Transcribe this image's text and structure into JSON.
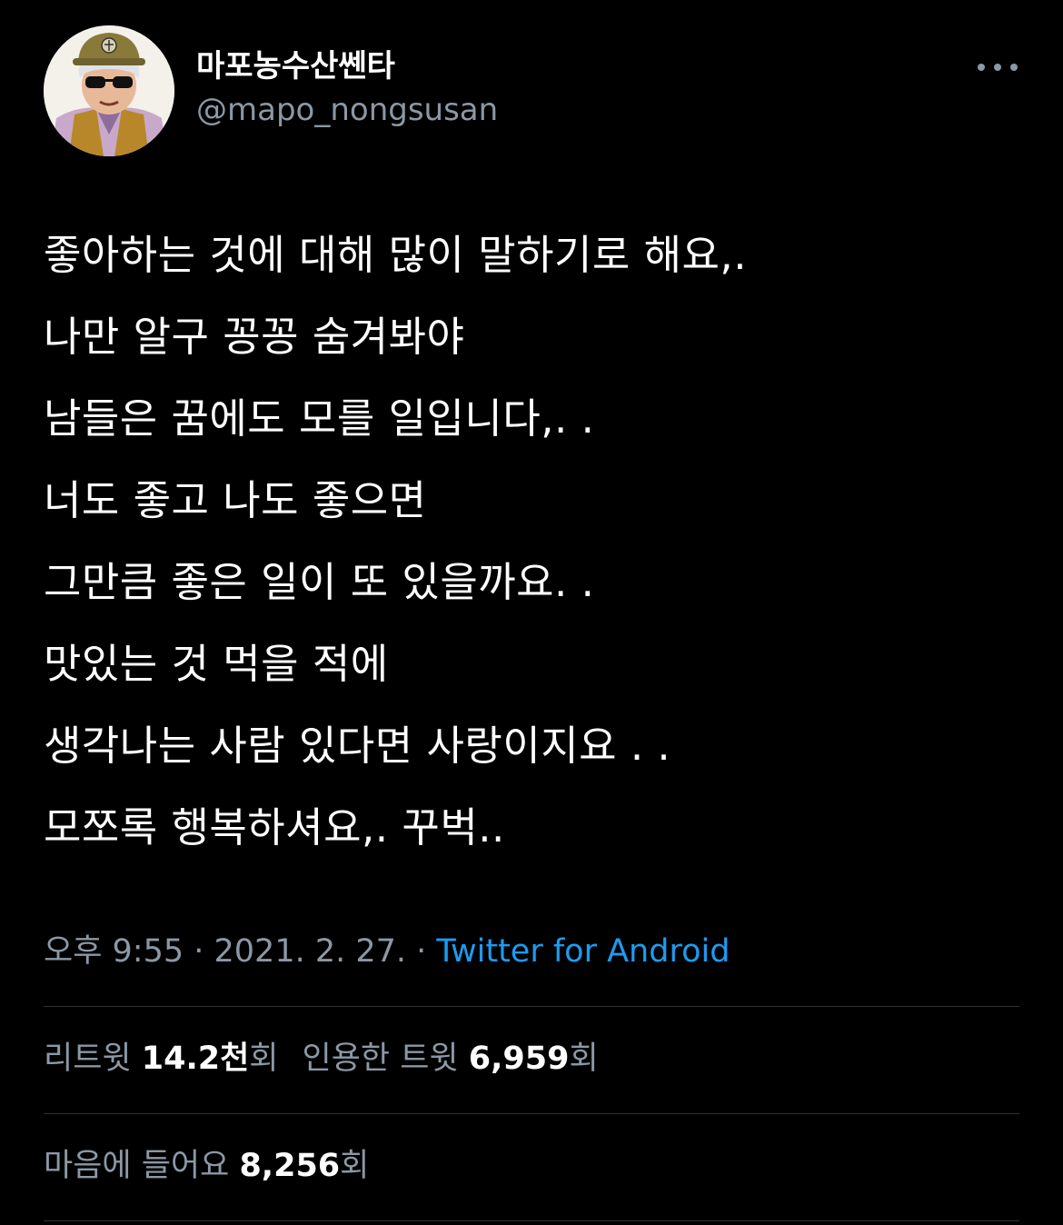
{
  "colors": {
    "background": "#000000",
    "text_primary": "#ffffff",
    "text_secondary": "#8b98a5",
    "link": "#1d9bf0",
    "divider": "#2f3336"
  },
  "author": {
    "display_name": "마포농수산쎈타",
    "handle": "@mapo_nongsusan",
    "avatar_icon": "avatar-illustration"
  },
  "more_menu_icon": "ellipsis-icon",
  "tweet": {
    "lines": [
      "좋아하는 것에 대해 많이 말하기로 해요,.",
      "나만 알구 꽁꽁 숨겨봐야",
      "남들은 꿈에도 모를 일입니다,. .",
      "너도 좋고 나도 좋으면",
      "그만큼 좋은 일이 또 있을까요. .",
      "맛있는 것 먹을 적에",
      "생각나는 사람 있다면 사랑이지요 . .",
      "모쪼록 행복하셔요,. 꾸벅.."
    ]
  },
  "meta": {
    "time": "오후 9:55",
    "separator": " · ",
    "date": "2021. 2. 27.",
    "source": "Twitter for Android"
  },
  "stats": {
    "retweets_label": "리트윗 ",
    "retweets_value": "14.2천",
    "retweets_suffix": "회",
    "quotes_label": "인용한 트윗 ",
    "quotes_value": "6,959",
    "quotes_suffix": "회",
    "likes_label": "마음에 들어요 ",
    "likes_value": "8,256",
    "likes_suffix": "회"
  }
}
